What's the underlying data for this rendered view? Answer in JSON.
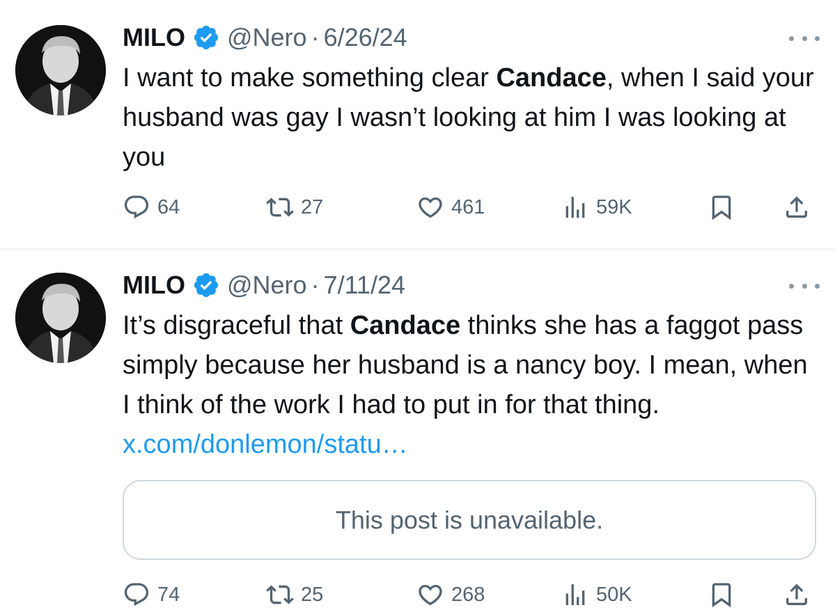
{
  "tweets": [
    {
      "name": "MILO",
      "handle": "@Nero",
      "separator": "·",
      "date": "6/26/24",
      "text_parts": [
        {
          "text": "I want to make something clear ",
          "bold": false
        },
        {
          "text": "Candace",
          "bold": true
        },
        {
          "text": ", when I said your husband was gay I wasn’t looking at him I was looking at you",
          "bold": false
        }
      ],
      "stats": {
        "replies": "64",
        "reposts": "27",
        "likes": "461",
        "views": "59K"
      }
    },
    {
      "name": "MILO",
      "handle": "@Nero",
      "separator": "·",
      "date": "7/11/24",
      "text_parts": [
        {
          "text": "It’s disgraceful that ",
          "bold": false
        },
        {
          "text": "Candace",
          "bold": true
        },
        {
          "text": " thinks she has a faggot pass simply because her husband is a nancy boy. I mean, when I think of the work I had to put in for that thing. ",
          "bold": false
        }
      ],
      "link": "x.com/donlemon/statu…",
      "quoted_post": "This post is unavailable.",
      "stats": {
        "replies": "74",
        "reposts": "25",
        "likes": "268",
        "views": "50K"
      }
    }
  ],
  "icons": {
    "verified": "verified-badge-icon",
    "more": "more-options-icon",
    "reply": "reply-icon",
    "repost": "repost-icon",
    "like": "heart-icon",
    "views": "views-icon",
    "bookmark": "bookmark-icon",
    "share": "share-icon"
  },
  "colors": {
    "verified": "#1d9bf0",
    "link": "#1d9bf0",
    "secondary_text": "#536471",
    "primary_text": "#0f1419",
    "divider": "#eff3f4"
  }
}
